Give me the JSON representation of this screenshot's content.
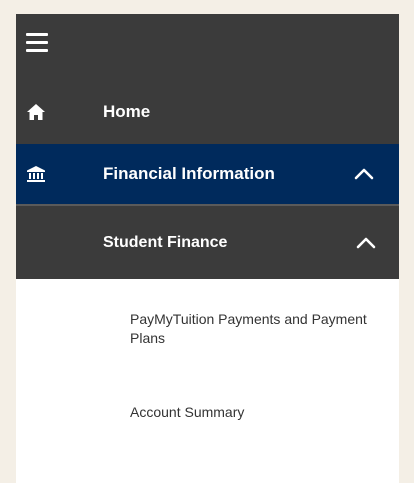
{
  "topbar": {
    "menu_icon": "hamburger-menu-icon"
  },
  "nav": {
    "home": {
      "label": "Home",
      "icon": "home-icon"
    },
    "financial_information": {
      "label": "Financial Information",
      "icon": "bank-icon",
      "expanded": true
    },
    "student_finance": {
      "label": "Student Finance",
      "expanded": true
    }
  },
  "submenu": {
    "items": [
      {
        "label": "PayMyTuition Payments and Payment Plans"
      },
      {
        "label": "Account Summary"
      }
    ]
  },
  "colors": {
    "dark_gray": "#3b3b3b",
    "navy": "#002a5c",
    "white": "#ffffff",
    "page_bg": "#f4efe6"
  }
}
